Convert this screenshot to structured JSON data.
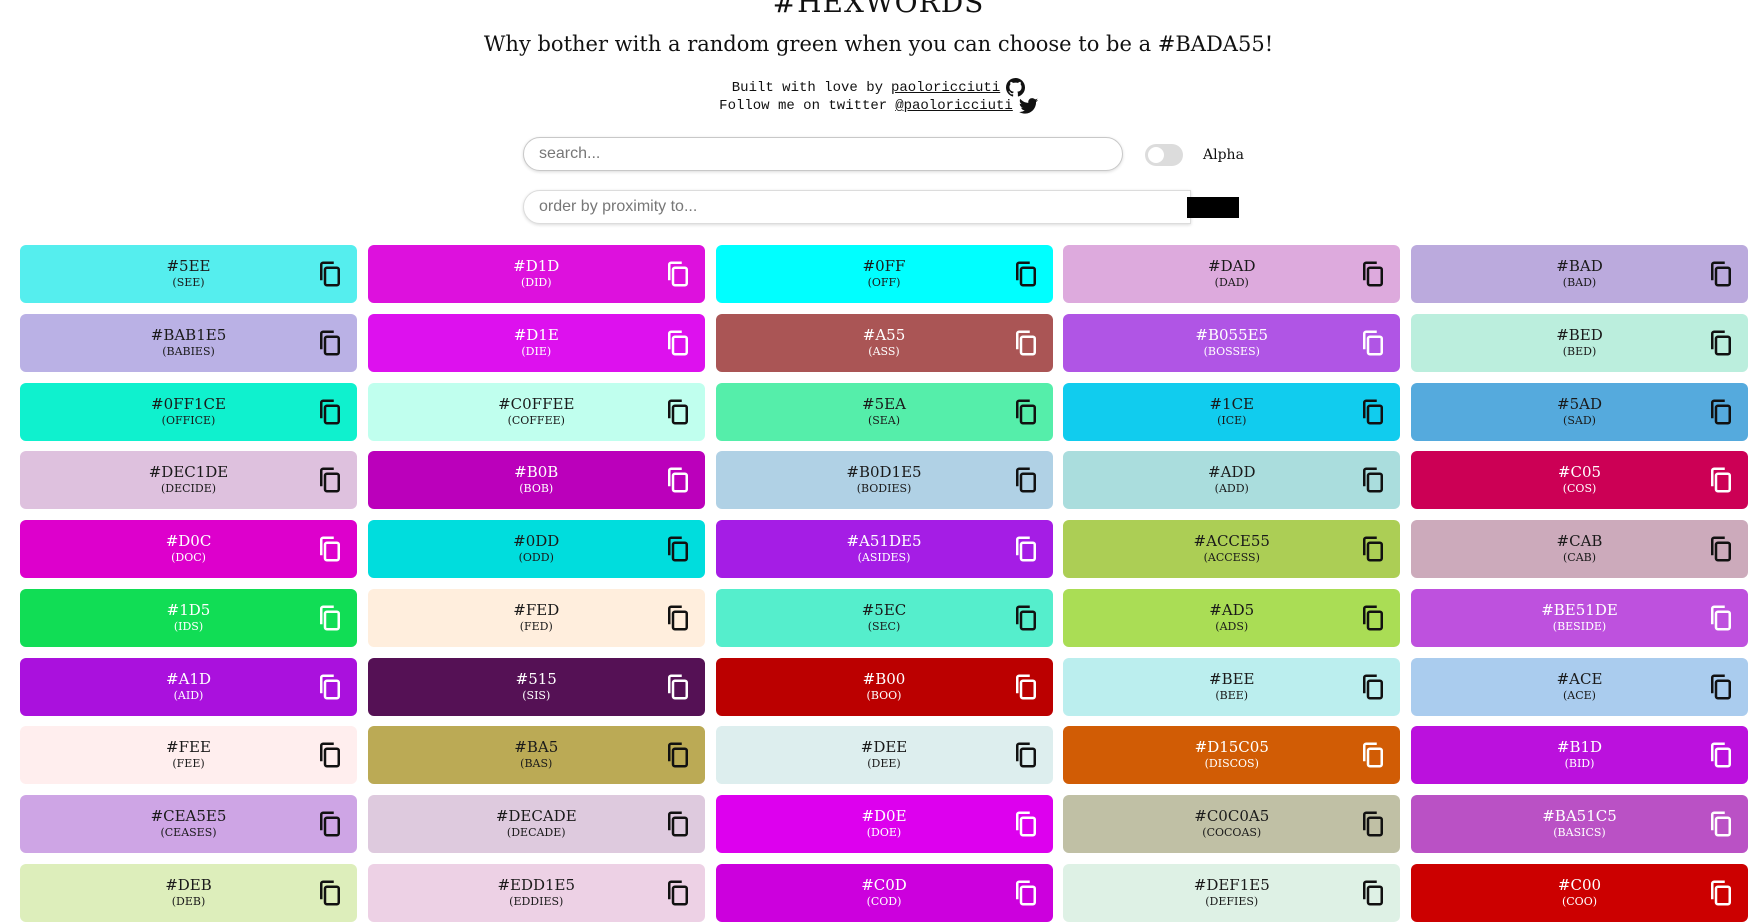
{
  "header": {
    "title": "#HEXWORDS",
    "subtitle": "Why bother with a random green when you can choose to be a #BADA55!",
    "credit_prefix": "Built with love by",
    "credit_link": "paoloricciuti",
    "twitter_prefix": "Follow me on twitter",
    "twitter_link": "@paoloricciuti"
  },
  "search": {
    "placeholder": "search...",
    "value": ""
  },
  "alpha": {
    "label": "Alpha",
    "on": false
  },
  "proximity": {
    "placeholder": "order by proximity to...",
    "value": "",
    "swatch": "#000000"
  },
  "icons": {
    "github": "github-icon",
    "twitter": "twitter-icon",
    "copy": "copy-icon"
  },
  "colors": [
    {
      "hex": "#5EE",
      "word": "(SEE)",
      "color": "#55EEEE"
    },
    {
      "hex": "#D1D",
      "word": "(DID)",
      "color": "#DD11DD"
    },
    {
      "hex": "#0FF",
      "word": "(OFF)",
      "color": "#00FFFF"
    },
    {
      "hex": "#DAD",
      "word": "(DAD)",
      "color": "#DDAADD"
    },
    {
      "hex": "#BAD",
      "word": "(BAD)",
      "color": "#BBAADD"
    },
    {
      "hex": "#BAB1E5",
      "word": "(BABIES)",
      "color": "#BAB1E5"
    },
    {
      "hex": "#D1E",
      "word": "(DIE)",
      "color": "#DD11EE"
    },
    {
      "hex": "#A55",
      "word": "(ASS)",
      "color": "#AA5555"
    },
    {
      "hex": "#B055E5",
      "word": "(BOSSES)",
      "color": "#B055E5"
    },
    {
      "hex": "#BED",
      "word": "(BED)",
      "color": "#BBEEDD"
    },
    {
      "hex": "#0FF1CE",
      "word": "(OFFICE)",
      "color": "#0FF1CE"
    },
    {
      "hex": "#C0FFEE",
      "word": "(COFFEE)",
      "color": "#C0FFEE"
    },
    {
      "hex": "#5EA",
      "word": "(SEA)",
      "color": "#55EEAA"
    },
    {
      "hex": "#1CE",
      "word": "(ICE)",
      "color": "#11CCEE"
    },
    {
      "hex": "#5AD",
      "word": "(SAD)",
      "color": "#55AADD"
    },
    {
      "hex": "#DEC1DE",
      "word": "(DECIDE)",
      "color": "#DEC1DE"
    },
    {
      "hex": "#B0B",
      "word": "(BOB)",
      "color": "#BB00BB"
    },
    {
      "hex": "#B0D1E5",
      "word": "(BODIES)",
      "color": "#B0D1E5"
    },
    {
      "hex": "#ADD",
      "word": "(ADD)",
      "color": "#AADDDD"
    },
    {
      "hex": "#C05",
      "word": "(COS)",
      "color": "#CC0055"
    },
    {
      "hex": "#D0C",
      "word": "(DOC)",
      "color": "#DD00CC"
    },
    {
      "hex": "#0DD",
      "word": "(ODD)",
      "color": "#00DDDD"
    },
    {
      "hex": "#A51DE5",
      "word": "(ASIDES)",
      "color": "#A51DE5"
    },
    {
      "hex": "#ACCE55",
      "word": "(ACCESS)",
      "color": "#ACCE55"
    },
    {
      "hex": "#CAB",
      "word": "(CAB)",
      "color": "#CCAABB"
    },
    {
      "hex": "#1D5",
      "word": "(IDS)",
      "color": "#11DD55"
    },
    {
      "hex": "#FED",
      "word": "(FED)",
      "color": "#FFEEDD"
    },
    {
      "hex": "#5EC",
      "word": "(SEC)",
      "color": "#55EECC"
    },
    {
      "hex": "#AD5",
      "word": "(ADS)",
      "color": "#AADD55"
    },
    {
      "hex": "#BE51DE",
      "word": "(BESIDE)",
      "color": "#BE51DE"
    },
    {
      "hex": "#A1D",
      "word": "(AID)",
      "color": "#AA11DD"
    },
    {
      "hex": "#515",
      "word": "(SIS)",
      "color": "#551155"
    },
    {
      "hex": "#B00",
      "word": "(BOO)",
      "color": "#BB0000"
    },
    {
      "hex": "#BEE",
      "word": "(BEE)",
      "color": "#BBEEEE"
    },
    {
      "hex": "#ACE",
      "word": "(ACE)",
      "color": "#AACCEE"
    },
    {
      "hex": "#FEE",
      "word": "(FEE)",
      "color": "#FFEEEE"
    },
    {
      "hex": "#BA5",
      "word": "(BAS)",
      "color": "#BBAA55"
    },
    {
      "hex": "#DEE",
      "word": "(DEE)",
      "color": "#DDEEEE"
    },
    {
      "hex": "#D15C05",
      "word": "(DISCOS)",
      "color": "#D15C05"
    },
    {
      "hex": "#B1D",
      "word": "(BID)",
      "color": "#BB11DD"
    },
    {
      "hex": "#CEA5E5",
      "word": "(CEASES)",
      "color": "#CEA5E5"
    },
    {
      "hex": "#DECADE",
      "word": "(DECADE)",
      "color": "#DECADE"
    },
    {
      "hex": "#D0E",
      "word": "(DOE)",
      "color": "#DD00EE"
    },
    {
      "hex": "#C0C0A5",
      "word": "(COCOAS)",
      "color": "#C0C0A5"
    },
    {
      "hex": "#BA51C5",
      "word": "(BASICS)",
      "color": "#BA51C5"
    },
    {
      "hex": "#DEB",
      "word": "(DEB)",
      "color": "#DDEEBB"
    },
    {
      "hex": "#EDD1E5",
      "word": "(EDDIES)",
      "color": "#EDD1E5"
    },
    {
      "hex": "#C0D",
      "word": "(COD)",
      "color": "#CC00DD"
    },
    {
      "hex": "#DEF1E5",
      "word": "(DEFIES)",
      "color": "#DEF1E5"
    },
    {
      "hex": "#C00",
      "word": "(COO)",
      "color": "#CC0000"
    }
  ]
}
